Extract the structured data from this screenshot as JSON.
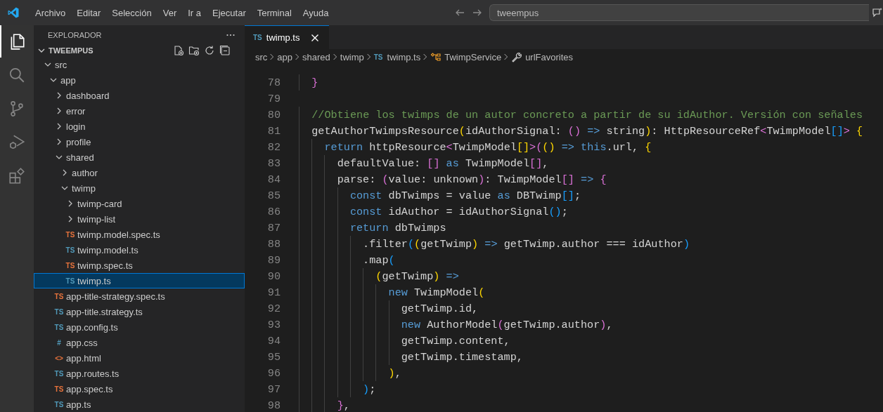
{
  "title_bar": {
    "menu": [
      "Archivo",
      "Editar",
      "Selección",
      "Ver",
      "Ir a",
      "Ejecutar",
      "Terminal",
      "Ayuda"
    ],
    "command_center": "tweempus"
  },
  "activity_bar": [
    {
      "kind": "explorer",
      "selected": true
    },
    {
      "kind": "search",
      "selected": false
    },
    {
      "kind": "source-control",
      "selected": false
    },
    {
      "kind": "run-debug",
      "selected": false
    },
    {
      "kind": "extensions",
      "selected": false
    }
  ],
  "explorer": {
    "title": "EXPLORADOR",
    "root": {
      "label": "TWEEMPUS",
      "expanded": true
    },
    "tree": [
      {
        "label": "src",
        "kind": "folder",
        "expanded": true,
        "selected": false,
        "children": [
          {
            "label": "app",
            "kind": "folder",
            "expanded": true,
            "selected": false,
            "children": [
              {
                "label": "dashboard",
                "kind": "folder",
                "expanded": false,
                "selected": false
              },
              {
                "label": "error",
                "kind": "folder",
                "expanded": false,
                "selected": false
              },
              {
                "label": "login",
                "kind": "folder",
                "expanded": false,
                "selected": false
              },
              {
                "label": "profile",
                "kind": "folder",
                "expanded": false,
                "selected": false
              },
              {
                "label": "shared",
                "kind": "folder",
                "expanded": true,
                "selected": false,
                "children": [
                  {
                    "label": "author",
                    "kind": "folder",
                    "expanded": false,
                    "selected": false
                  },
                  {
                    "label": "twimp",
                    "kind": "folder",
                    "expanded": true,
                    "selected": false,
                    "children": [
                      {
                        "label": "twimp-card",
                        "kind": "folder",
                        "expanded": false,
                        "selected": false
                      },
                      {
                        "label": "twimp-list",
                        "kind": "folder",
                        "expanded": false,
                        "selected": false
                      },
                      {
                        "label": "twimp.model.spec.ts",
                        "kind": "file",
                        "badge": "TS",
                        "color": "#e8733c",
                        "selected": false
                      },
                      {
                        "label": "twimp.model.ts",
                        "kind": "file",
                        "badge": "TS",
                        "color": "#519aba",
                        "selected": false
                      },
                      {
                        "label": "twimp.spec.ts",
                        "kind": "file",
                        "badge": "TS",
                        "color": "#e8733c",
                        "selected": false
                      },
                      {
                        "label": "twimp.ts",
                        "kind": "file",
                        "badge": "TS",
                        "color": "#519aba",
                        "selected": true
                      }
                    ]
                  }
                ]
              },
              {
                "label": "app-title-strategy.spec.ts",
                "kind": "file",
                "badge": "TS",
                "color": "#e8733c",
                "selected": false
              },
              {
                "label": "app-title.strategy.ts",
                "kind": "file",
                "badge": "TS",
                "color": "#519aba",
                "selected": false
              },
              {
                "label": "app.config.ts",
                "kind": "file",
                "badge": "TS",
                "color": "#519aba",
                "selected": false
              },
              {
                "label": "app.css",
                "kind": "file",
                "badge": "#",
                "color": "#519aba",
                "selected": false
              },
              {
                "label": "app.html",
                "kind": "file",
                "badge": "<>",
                "color": "#e8733c",
                "selected": false
              },
              {
                "label": "app.routes.ts",
                "kind": "file",
                "badge": "TS",
                "color": "#519aba",
                "selected": false
              },
              {
                "label": "app.spec.ts",
                "kind": "file",
                "badge": "TS",
                "color": "#e8733c",
                "selected": false
              },
              {
                "label": "app.ts",
                "kind": "file",
                "badge": "TS",
                "color": "#519aba",
                "selected": false
              }
            ]
          }
        ]
      }
    ]
  },
  "tabs": [
    {
      "label": "twimp.ts",
      "badge": "TS",
      "selected": true
    }
  ],
  "breadcrumb": [
    {
      "label": "src",
      "kind": "folder"
    },
    {
      "label": "app",
      "kind": "folder"
    },
    {
      "label": "shared",
      "kind": "folder"
    },
    {
      "label": "twimp",
      "kind": "folder"
    },
    {
      "label": "twimp.ts",
      "kind": "file",
      "badge": "TS"
    },
    {
      "label": "TwimpService",
      "kind": "class"
    },
    {
      "label": "urlFavorites",
      "kind": "property"
    }
  ],
  "editor": {
    "lines": [
      {
        "number": "78",
        "tokens": [
          {
            "kind": "paren2",
            "text": "  }"
          }
        ]
      },
      {
        "number": "79"
      },
      {
        "number": "80",
        "tokens": [
          {
            "kind": "comment",
            "text": "  //Obtiene los twimps de un autor concreto a partir de su idAuthor. Versión con señales"
          }
        ]
      },
      {
        "number": "81",
        "tokens": [
          {
            "kind": "plain",
            "text": "  getAuthorTwimpsResource"
          },
          {
            "kind": "paren1",
            "text": "("
          },
          {
            "kind": "plain",
            "text": "idAuthorSignal: "
          },
          {
            "kind": "paren2",
            "text": "()"
          },
          {
            "kind": "keyword",
            "text": " => "
          },
          {
            "kind": "plain",
            "text": "string"
          },
          {
            "kind": "paren1",
            "text": ")"
          },
          {
            "kind": "plain",
            "text": ": HttpResourceRef"
          },
          {
            "kind": "paren2",
            "text": "<"
          },
          {
            "kind": "plain",
            "text": "TwimpModel"
          },
          {
            "kind": "paren3",
            "text": "[]"
          },
          {
            "kind": "paren2",
            "text": ">"
          },
          {
            "kind": "paren1",
            "text": " {"
          }
        ]
      },
      {
        "number": "82",
        "tokens": [
          {
            "kind": "keyword",
            "text": "    return"
          },
          {
            "kind": "plain",
            "text": " httpResource"
          },
          {
            "kind": "paren2",
            "text": "<"
          },
          {
            "kind": "plain",
            "text": "TwimpModel"
          },
          {
            "kind": "paren1",
            "text": "[]"
          },
          {
            "kind": "paren2",
            "text": ">"
          },
          {
            "kind": "paren2",
            "text": "("
          },
          {
            "kind": "paren1",
            "text": "()"
          },
          {
            "kind": "keyword",
            "text": " => "
          },
          {
            "kind": "keyword",
            "text": "this"
          },
          {
            "kind": "plain",
            "text": ".url, "
          },
          {
            "kind": "paren1",
            "text": "{"
          }
        ]
      },
      {
        "number": "83",
        "tokens": [
          {
            "kind": "plain",
            "text": "      defaultValue: "
          },
          {
            "kind": "paren2",
            "text": "[]"
          },
          {
            "kind": "keyword",
            "text": " as"
          },
          {
            "kind": "plain",
            "text": " TwimpModel"
          },
          {
            "kind": "paren2",
            "text": "[]"
          },
          {
            "kind": "plain",
            "text": ","
          }
        ]
      },
      {
        "number": "84",
        "tokens": [
          {
            "kind": "plain",
            "text": "      parse: "
          },
          {
            "kind": "paren2",
            "text": "("
          },
          {
            "kind": "plain",
            "text": "value: unknown"
          },
          {
            "kind": "paren2",
            "text": ")"
          },
          {
            "kind": "plain",
            "text": ": TwimpModel"
          },
          {
            "kind": "paren2",
            "text": "[]"
          },
          {
            "kind": "keyword",
            "text": " => "
          },
          {
            "kind": "paren2",
            "text": "{"
          }
        ]
      },
      {
        "number": "85",
        "tokens": [
          {
            "kind": "keyword",
            "text": "        const"
          },
          {
            "kind": "plain",
            "text": " dbTwimps = value "
          },
          {
            "kind": "keyword",
            "text": "as"
          },
          {
            "kind": "plain",
            "text": " DBTwimp"
          },
          {
            "kind": "paren3",
            "text": "[]"
          },
          {
            "kind": "plain",
            "text": ";"
          }
        ]
      },
      {
        "number": "86",
        "tokens": [
          {
            "kind": "keyword",
            "text": "        const"
          },
          {
            "kind": "plain",
            "text": " idAuthor = idAuthorSignal"
          },
          {
            "kind": "paren3",
            "text": "()"
          },
          {
            "kind": "plain",
            "text": ";"
          }
        ]
      },
      {
        "number": "87",
        "tokens": [
          {
            "kind": "keyword",
            "text": "        return"
          },
          {
            "kind": "plain",
            "text": " dbTwimps"
          }
        ]
      },
      {
        "number": "88",
        "tokens": [
          {
            "kind": "plain",
            "text": "          .filter"
          },
          {
            "kind": "paren3",
            "text": "("
          },
          {
            "kind": "paren1",
            "text": "("
          },
          {
            "kind": "plain",
            "text": "getTwimp"
          },
          {
            "kind": "paren1",
            "text": ")"
          },
          {
            "kind": "keyword",
            "text": " => "
          },
          {
            "kind": "plain",
            "text": "getTwimp.author === idAuthor"
          },
          {
            "kind": "paren3",
            "text": ")"
          }
        ]
      },
      {
        "number": "89",
        "tokens": [
          {
            "kind": "plain",
            "text": "          .map"
          },
          {
            "kind": "paren3",
            "text": "("
          }
        ]
      },
      {
        "number": "90",
        "tokens": [
          {
            "kind": "paren1",
            "text": "            ("
          },
          {
            "kind": "plain",
            "text": "getTwimp"
          },
          {
            "kind": "paren1",
            "text": ")"
          },
          {
            "kind": "keyword",
            "text": " =>"
          }
        ]
      },
      {
        "number": "91",
        "tokens": [
          {
            "kind": "keyword",
            "text": "              new"
          },
          {
            "kind": "plain",
            "text": " TwimpModel"
          },
          {
            "kind": "paren1",
            "text": "("
          }
        ]
      },
      {
        "number": "92",
        "tokens": [
          {
            "kind": "plain",
            "text": "                getTwimp.id,"
          }
        ]
      },
      {
        "number": "93",
        "tokens": [
          {
            "kind": "keyword",
            "text": "                new"
          },
          {
            "kind": "plain",
            "text": " AuthorModel"
          },
          {
            "kind": "paren2",
            "text": "("
          },
          {
            "kind": "plain",
            "text": "getTwimp.author"
          },
          {
            "kind": "paren2",
            "text": ")"
          },
          {
            "kind": "plain",
            "text": ","
          }
        ]
      },
      {
        "number": "94",
        "tokens": [
          {
            "kind": "plain",
            "text": "                getTwimp.content,"
          }
        ]
      },
      {
        "number": "95",
        "tokens": [
          {
            "kind": "plain",
            "text": "                getTwimp.timestamp,"
          }
        ]
      },
      {
        "number": "96",
        "tokens": [
          {
            "kind": "paren1",
            "text": "              )"
          },
          {
            "kind": "plain",
            "text": ","
          }
        ]
      },
      {
        "number": "97",
        "tokens": [
          {
            "kind": "paren3",
            "text": "          )"
          },
          {
            "kind": "plain",
            "text": ";"
          }
        ]
      },
      {
        "number": "98",
        "tokens": [
          {
            "kind": "paren2",
            "text": "      }"
          },
          {
            "kind": "plain",
            "text": ","
          }
        ]
      }
    ]
  }
}
